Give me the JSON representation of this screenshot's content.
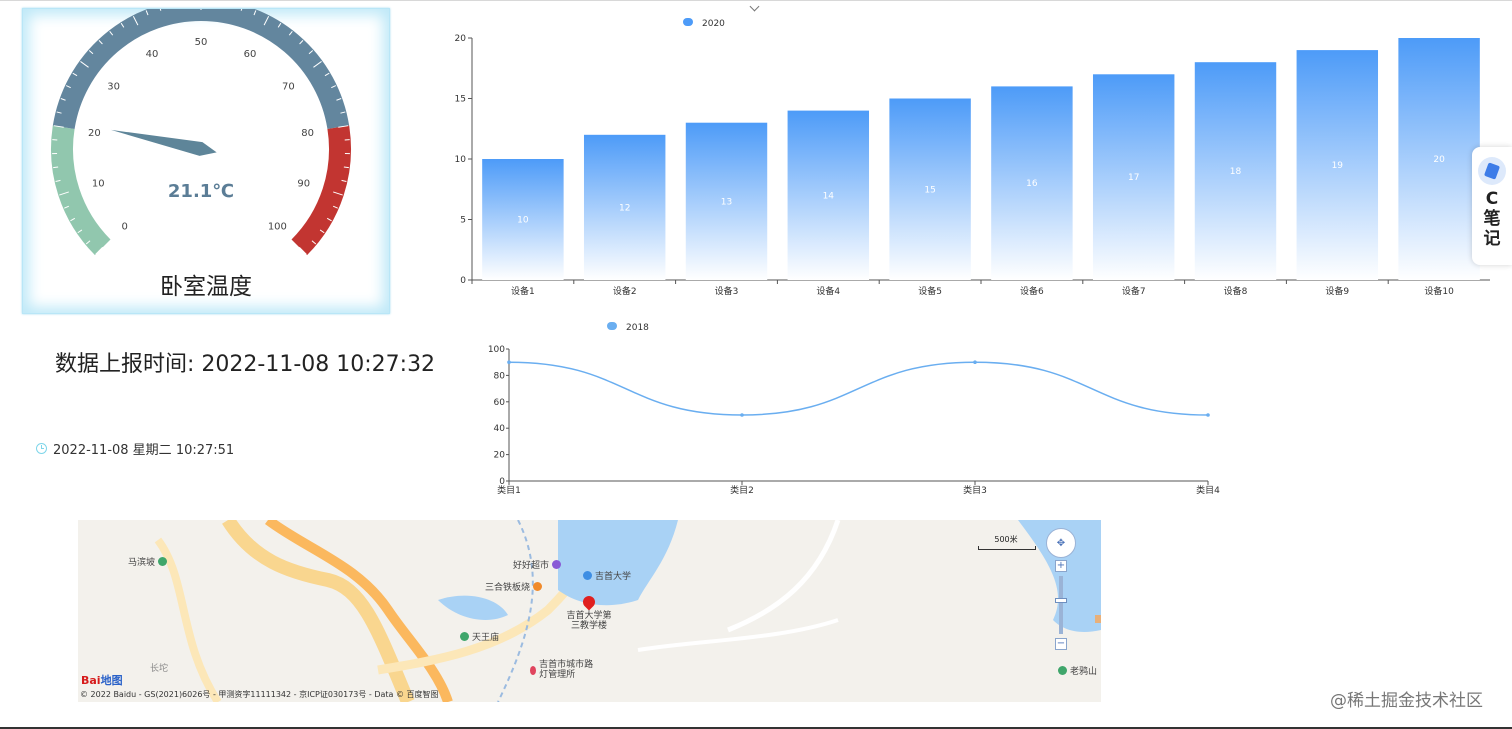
{
  "gauge": {
    "title": "卧室温度",
    "value": 21.1,
    "value_label": "21.1℃",
    "min": 0,
    "max": 100,
    "tick_labels": [
      "0",
      "10",
      "20",
      "30",
      "40",
      "50",
      "60",
      "70",
      "80",
      "90",
      "100"
    ],
    "colors": {
      "low": "#91c7ae",
      "mid": "#63869e",
      "high": "#c23531"
    },
    "bands": [
      0.2,
      0.8,
      1.0
    ]
  },
  "report_time": "数据上报时间: 2022-11-08 10:27:32",
  "clock": {
    "icon": "clock-icon",
    "text": "2022-11-08 星期二 10:27:51"
  },
  "chart_data": [
    {
      "type": "bar",
      "legend": [
        "2020"
      ],
      "categories": [
        "设备1",
        "设备2",
        "设备3",
        "设备4",
        "设备5",
        "设备6",
        "设备7",
        "设备8",
        "设备9",
        "设备10"
      ],
      "series": [
        {
          "name": "2020",
          "values": [
            10,
            12,
            13,
            14,
            15,
            16,
            17,
            18,
            19,
            20
          ]
        }
      ],
      "ylim": [
        0,
        20
      ],
      "yticks": [
        0,
        5,
        10,
        15,
        20
      ],
      "data_labels": true,
      "gradient": [
        "#4d9bf8",
        "#ffffff"
      ],
      "legend_position": "top-left"
    },
    {
      "type": "line",
      "legend": [
        "2018"
      ],
      "categories": [
        "类目1",
        "类目2",
        "类目3",
        "类目4"
      ],
      "series": [
        {
          "name": "2018",
          "values": [
            90,
            50,
            90,
            50
          ]
        }
      ],
      "ylim": [
        0,
        100
      ],
      "yticks": [
        0,
        20,
        40,
        60,
        80,
        100
      ],
      "smooth": true,
      "color": "#6aaef0",
      "legend_position": "top-left"
    }
  ],
  "map": {
    "pois": [
      "马滨坡",
      "好好超市",
      "吉首大学",
      "三合铁板烧",
      "吉首大学第三教学楼",
      "天王庙",
      "吉首市城市路灯管理所",
      "老鸦山",
      "长坨"
    ],
    "scale_label": "500米",
    "copyright": "© 2022 Baidu - GS(2021)6026号 - 甲测资字11111342 - 京ICP证030173号 - Data © 百度智图",
    "logo": "Bai地图",
    "nav_icon": "map-nav-icon"
  },
  "side_widget": {
    "icon": "note-icon",
    "label": "C笔记"
  },
  "watermark": "@稀土掘金技术社区"
}
